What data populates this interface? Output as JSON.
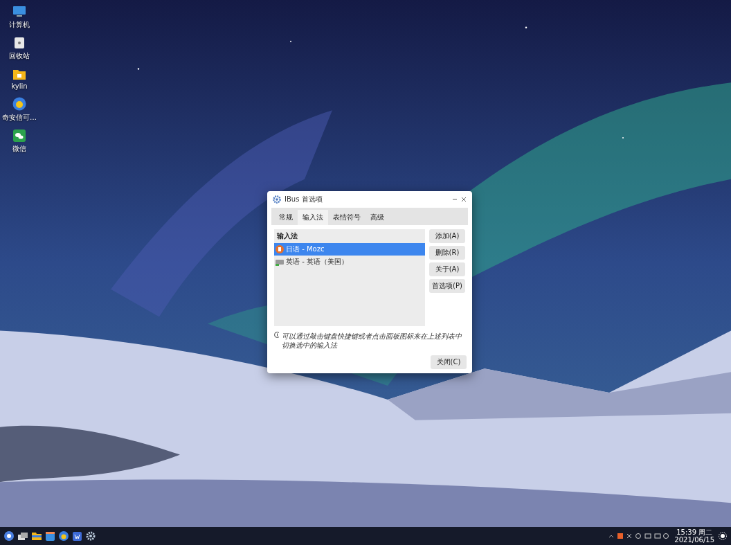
{
  "desktop_icons": [
    {
      "kind": "monitor",
      "label": "计算机"
    },
    {
      "kind": "trash",
      "label": "回收站"
    },
    {
      "kind": "folder",
      "label": "kylin"
    },
    {
      "kind": "browser",
      "label": "奇安信可…"
    },
    {
      "kind": "chat",
      "label": "微信"
    }
  ],
  "dialog": {
    "title": "IBus 首选项",
    "tabs": [
      {
        "label": "常规",
        "selected": false
      },
      {
        "label": "输入法",
        "selected": true
      },
      {
        "label": "表情符号",
        "selected": false
      },
      {
        "label": "高级",
        "selected": false
      }
    ],
    "list_header": "输入法",
    "input_methods": [
      {
        "kind": "mozc",
        "label": "日语 - Mozc",
        "selected": true
      },
      {
        "kind": "keyboard",
        "label": "英语 - 英语（美国）",
        "selected": false
      }
    ],
    "side_buttons": [
      "添加(A)",
      "删除(R)",
      "关于(A)",
      "首选项(P)"
    ],
    "hint": "可以通过敲击键盘快捷键或者点击面板图标来在上述列表中切换选中的输入法",
    "close_button": "关闭(C)"
  },
  "taskbar": {
    "apps": [
      {
        "kind": "start"
      },
      {
        "kind": "files"
      },
      {
        "kind": "folder"
      },
      {
        "kind": "store"
      },
      {
        "kind": "browser"
      },
      {
        "kind": "writer"
      },
      {
        "kind": "settings"
      }
    ],
    "time": "15:39 周二",
    "date": "2021/06/15"
  }
}
